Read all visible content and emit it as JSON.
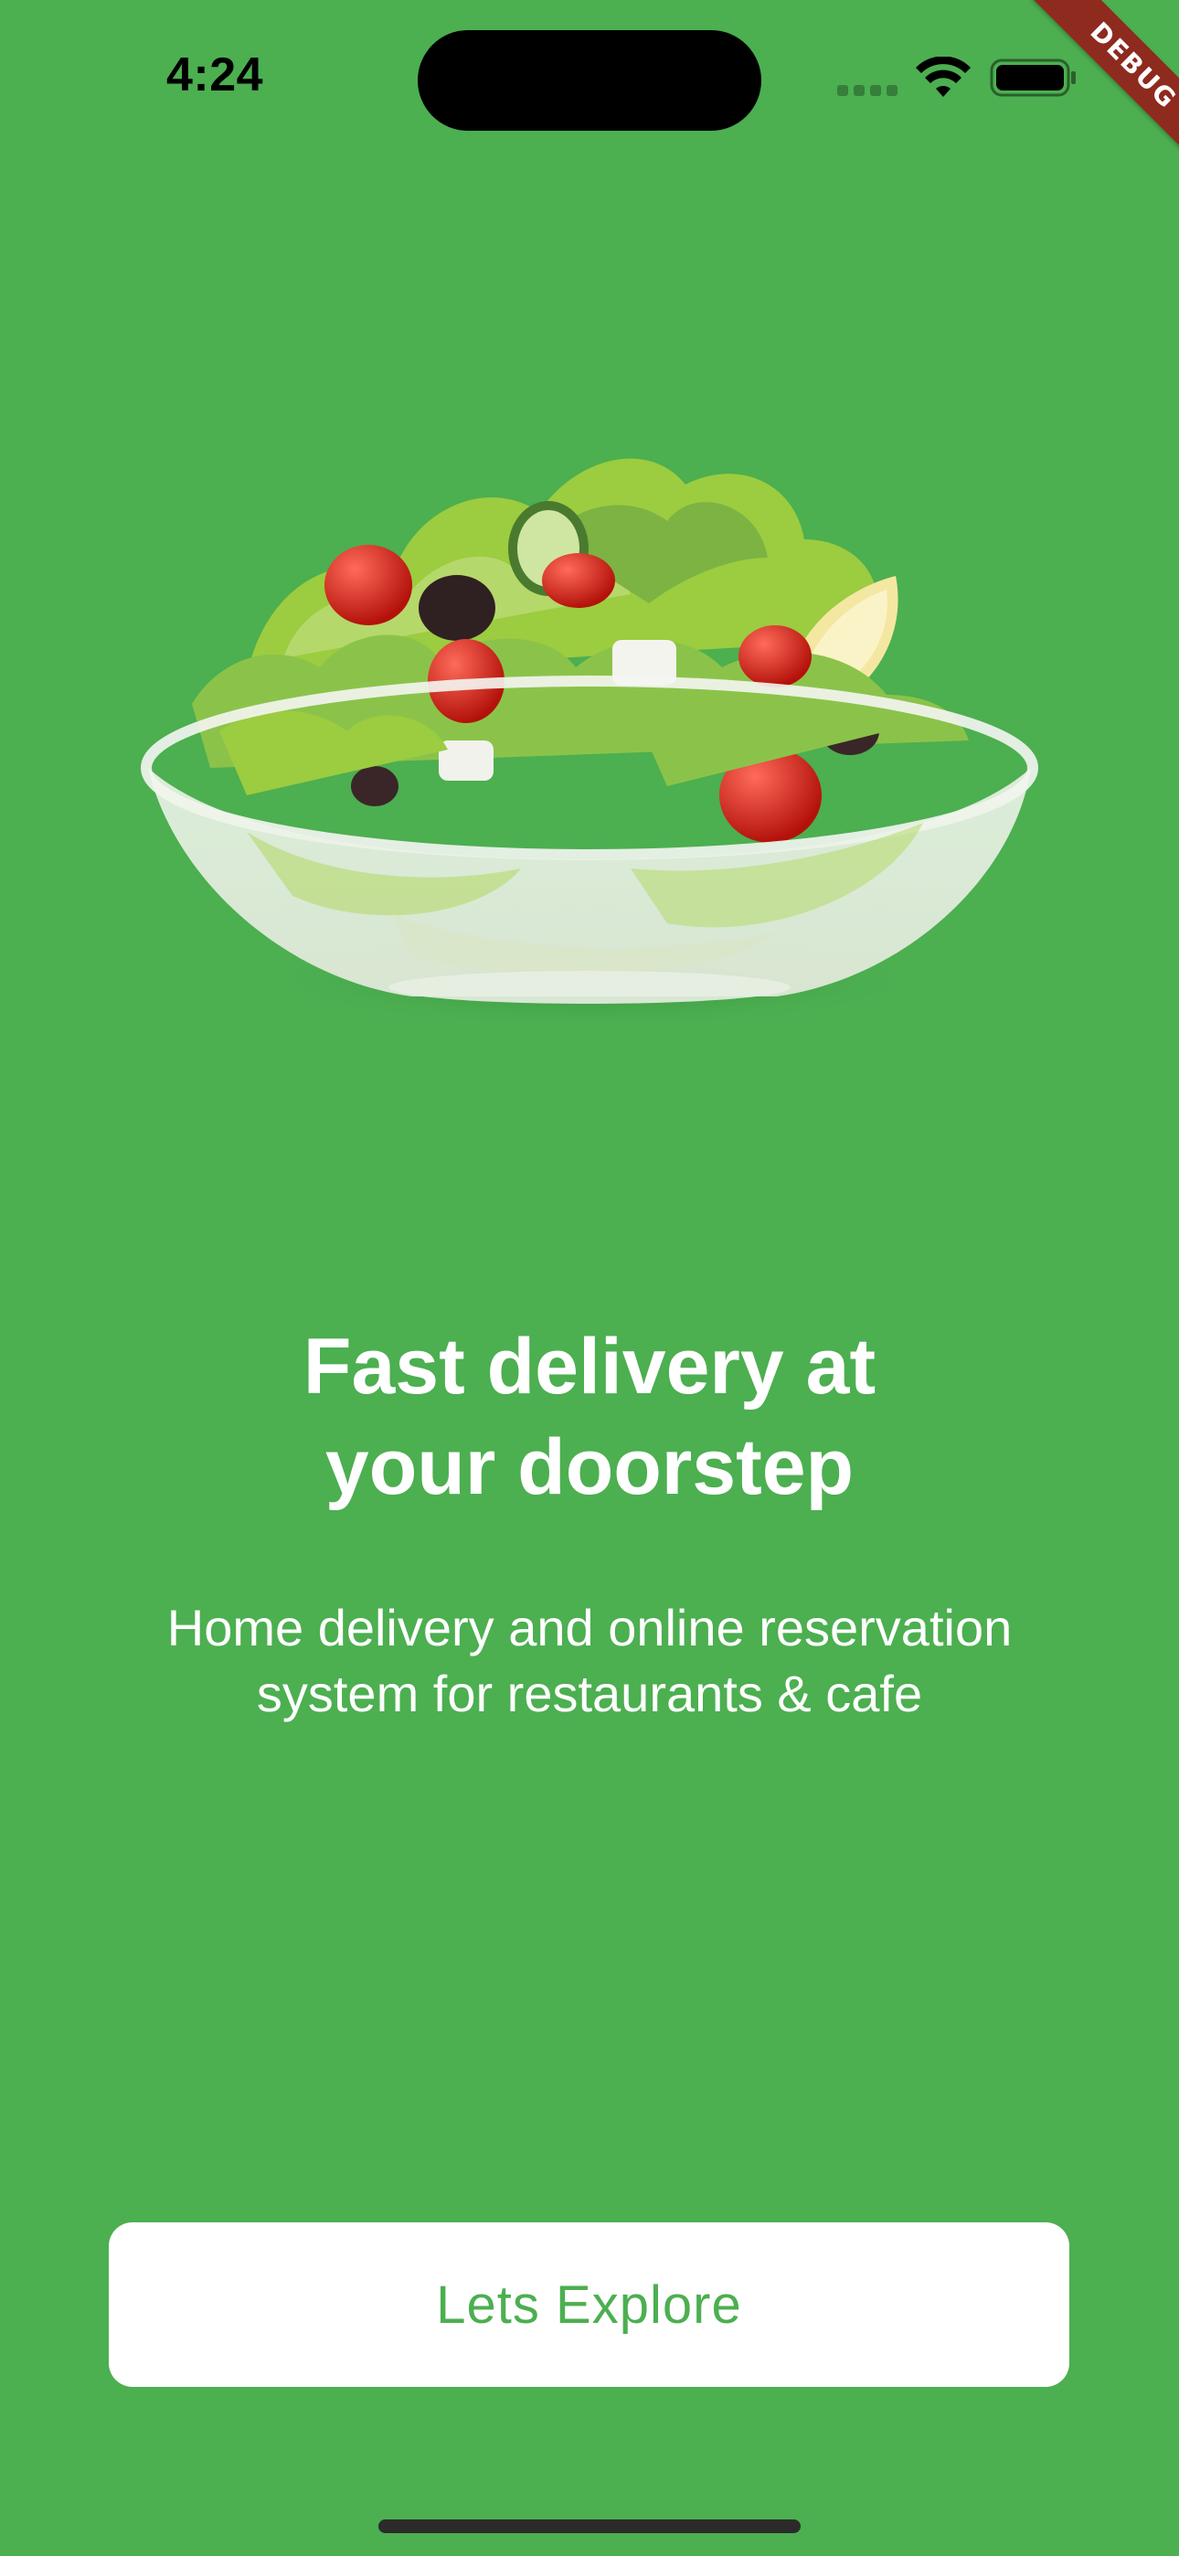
{
  "status_bar": {
    "time": "4:24",
    "icons": [
      "cellular-signal-icon",
      "wifi-icon",
      "battery-icon"
    ]
  },
  "debug_banner": {
    "label": "DEBUG"
  },
  "hero_image": {
    "subject": "salad-bowl"
  },
  "onboarding": {
    "headline_line1": "Fast delivery at",
    "headline_line2": "your doorstep",
    "subtitle_line1": "Home delivery and online reservation",
    "subtitle_line2": "system for restaurants & cafe",
    "cta_label": "Lets Explore"
  },
  "colors": {
    "background": "#4CAF50",
    "button_background": "#FFFFFF",
    "button_text": "#4CAF50",
    "text": "#FFFFFF"
  }
}
